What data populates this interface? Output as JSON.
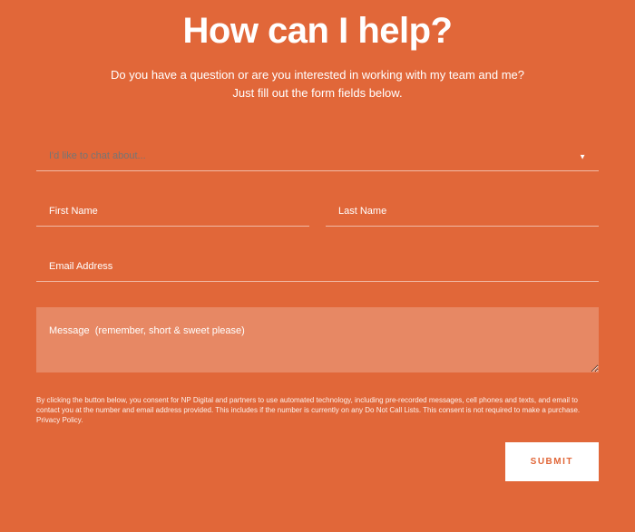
{
  "header": {
    "title": "How can I help?",
    "subtitle_line1": "Do you have a question or are you interested in working with my team and me?",
    "subtitle_line2": "Just fill out the form fields below."
  },
  "form": {
    "topic_placeholder": "I'd like to chat about...",
    "first_name_placeholder": "First Name",
    "last_name_placeholder": "Last Name",
    "email_placeholder": "Email Address",
    "message_placeholder": "Message  (remember, short & sweet please)",
    "consent_text": "By clicking the button below, you consent for NP Digital and partners to use automated technology, including pre-recorded messages, cell phones and texts, and email to contact you at the number and email address provided. This includes if the number is currently on any Do Not Call Lists. This consent is not required to make a purchase. Privacy Policy.",
    "submit_label": "SUBMIT"
  },
  "colors": {
    "background": "#e16739",
    "text_on_accent": "#ffffff",
    "button_bg": "#ffffff",
    "button_text": "#e16739"
  }
}
